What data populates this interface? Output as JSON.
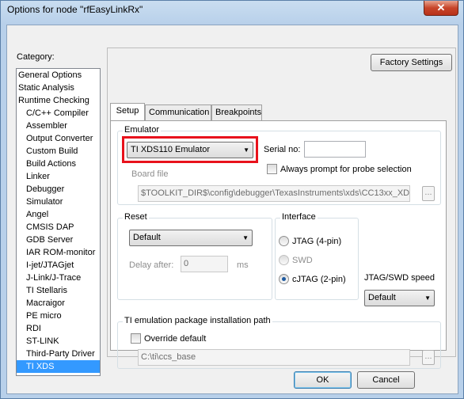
{
  "window": {
    "title": "Options for node \"rfEasyLinkRx\"",
    "close_glyph": "✕"
  },
  "category": {
    "label": "Category:",
    "items": [
      {
        "label": "General Options",
        "child": false
      },
      {
        "label": "Static Analysis",
        "child": false
      },
      {
        "label": "Runtime Checking",
        "child": false
      },
      {
        "label": "C/C++ Compiler",
        "child": true
      },
      {
        "label": "Assembler",
        "child": true
      },
      {
        "label": "Output Converter",
        "child": true
      },
      {
        "label": "Custom Build",
        "child": true
      },
      {
        "label": "Build Actions",
        "child": true
      },
      {
        "label": "Linker",
        "child": true
      },
      {
        "label": "Debugger",
        "child": true
      },
      {
        "label": "Simulator",
        "child": true
      },
      {
        "label": "Angel",
        "child": true
      },
      {
        "label": "CMSIS DAP",
        "child": true
      },
      {
        "label": "GDB Server",
        "child": true
      },
      {
        "label": "IAR ROM-monitor",
        "child": true
      },
      {
        "label": "I-jet/JTAGjet",
        "child": true
      },
      {
        "label": "J-Link/J-Trace",
        "child": true
      },
      {
        "label": "TI Stellaris",
        "child": true
      },
      {
        "label": "Macraigor",
        "child": true
      },
      {
        "label": "PE micro",
        "child": true
      },
      {
        "label": "RDI",
        "child": true
      },
      {
        "label": "ST-LINK",
        "child": true
      },
      {
        "label": "Third-Party Driver",
        "child": true
      },
      {
        "label": "TI XDS",
        "child": true,
        "selected": true
      }
    ]
  },
  "factory_settings_label": "Factory Settings",
  "tabs": [
    {
      "label": "Setup",
      "active": true
    },
    {
      "label": "Communication",
      "active": false
    },
    {
      "label": "Breakpoints",
      "active": false
    }
  ],
  "emulator": {
    "group_title": "Emulator",
    "selected": "TI XDS110 Emulator",
    "serial_label": "Serial no:",
    "serial_value": "",
    "always_prompt_label": "Always prompt for probe selection",
    "always_prompt_checked": false,
    "board_file_label": "Board file",
    "board_file_value": "$TOOLKIT_DIR$\\config\\debugger\\TexasInstruments\\xds\\CC13xx_XD",
    "browse_label": "..."
  },
  "reset": {
    "group_title": "Reset",
    "selected": "Default",
    "delay_label": "Delay after:",
    "delay_value": "0",
    "delay_unit": "ms"
  },
  "interface": {
    "group_title": "Interface",
    "options": [
      {
        "label": "JTAG  (4-pin)",
        "checked": false,
        "enabled": true
      },
      {
        "label": "SWD",
        "checked": false,
        "enabled": false
      },
      {
        "label": "cJTAG  (2-pin)",
        "checked": true,
        "enabled": true
      }
    ]
  },
  "speed": {
    "label": "JTAG/SWD speed",
    "selected": "Default"
  },
  "ti_package": {
    "group_title": "TI emulation package installation path",
    "override_label": "Override default",
    "override_checked": false,
    "path_value": "C:\\ti\\ccs_base",
    "browse_label": "..."
  },
  "buttons": {
    "ok": "OK",
    "cancel": "Cancel"
  },
  "colors": {
    "highlight": "#e8121c",
    "selection": "#3399ff"
  }
}
